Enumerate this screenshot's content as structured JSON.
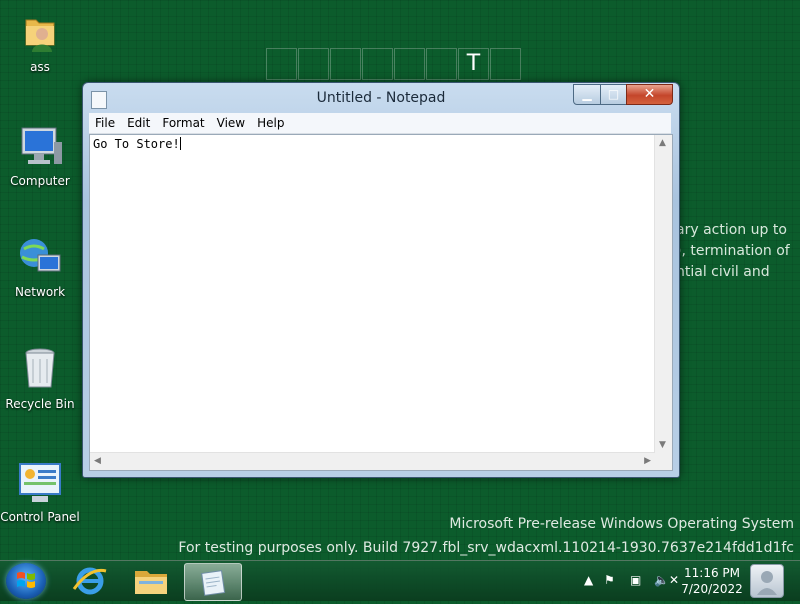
{
  "desktop": {
    "icons": [
      {
        "label": "ass"
      },
      {
        "label": "Computer"
      },
      {
        "label": "Network"
      },
      {
        "label": "Recycle Bin"
      },
      {
        "label": "Control Panel"
      }
    ],
    "tile_letter": "T",
    "background_text": [
      "ary action up to",
      "), termination of",
      "ntial civil and"
    ],
    "watermark_line1": "Microsoft Pre-release Windows Operating System",
    "watermark_line2": "For testing purposes only. Build 7927.fbl_srv_wdacxml.110214-1930.7637e214fdd1d1fc"
  },
  "notepad": {
    "title": "Untitled - Notepad",
    "menu": [
      "File",
      "Edit",
      "Format",
      "View",
      "Help"
    ],
    "content": "Go To Store!"
  },
  "taskbar": {
    "time": "11:16 PM",
    "date": "7/20/2022"
  }
}
